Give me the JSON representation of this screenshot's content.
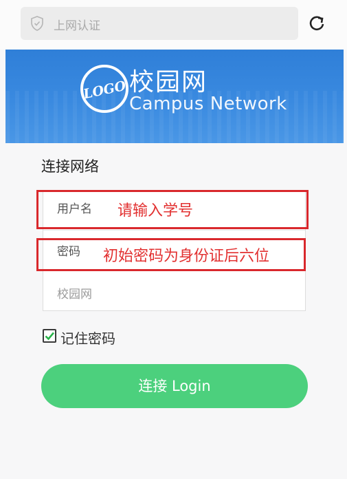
{
  "browser": {
    "url_text": "上网认证"
  },
  "banner": {
    "logo_text": "LOGO",
    "title_cn": "校园网",
    "title_en": "Campus Network"
  },
  "form": {
    "title": "连接网络",
    "fields": [
      {
        "label": "用户名",
        "hint": "请输入学号"
      },
      {
        "label": "密码",
        "hint": "初始密码为身份证后六位"
      },
      {
        "label": "校园网"
      }
    ],
    "remember": {
      "label": "记住密码",
      "checked": true
    },
    "submit_label": "连接 Login"
  },
  "colors": {
    "banner_blue": "#3a8ae0",
    "button_green": "#4cd07d",
    "annotation_red": "#d9282c"
  }
}
